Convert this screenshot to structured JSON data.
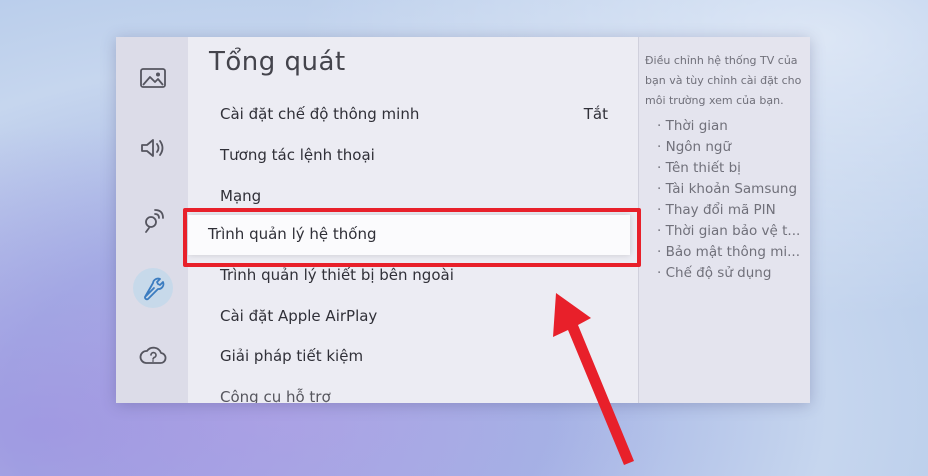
{
  "main": {
    "title": "Tổng quát",
    "items": [
      {
        "label": "Cài đặt chế độ thông minh",
        "value": "Tắt"
      },
      {
        "label": "Tương tác lệnh thoại"
      },
      {
        "label": "Mạng"
      },
      {
        "label": "Trình quản lý hệ thống"
      },
      {
        "label": "Trình quản lý thiết bị bên ngoài"
      },
      {
        "label": "Cài đặt Apple AirPlay"
      },
      {
        "label": "Giải pháp tiết kiệm"
      },
      {
        "label": "Công cụ hỗ trợ"
      }
    ],
    "selected_index": 3
  },
  "description": {
    "text": "Điều chỉnh hệ thống TV của bạn và tùy chỉnh cài đặt cho môi trường xem của bạn.",
    "items": [
      "Thời gian",
      "Ngôn ngữ",
      "Tên thiết bị",
      "Tài khoản Samsung",
      "Thay đổi mã PIN",
      "Thời gian bảo vệ t...",
      "Bảo mật thông mi...",
      "Chế độ sử dụng"
    ]
  },
  "sidebar": {
    "icons": [
      "picture-icon",
      "sound-icon",
      "broadcast-icon",
      "wrench-icon",
      "support-icon"
    ],
    "active_index": 3
  },
  "colors": {
    "highlight": "#e8202a",
    "accent": "#4a86c4"
  }
}
